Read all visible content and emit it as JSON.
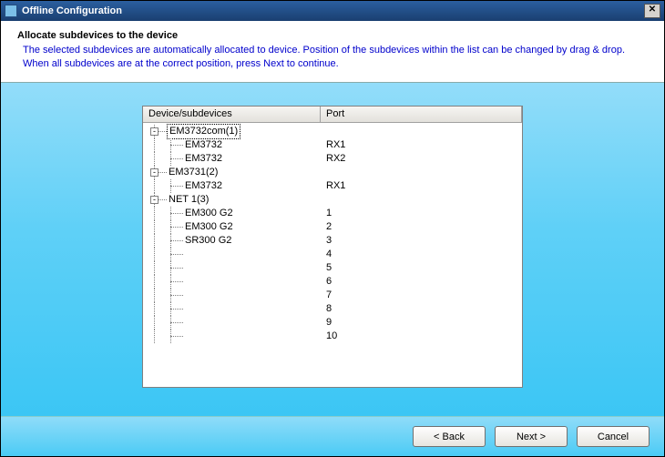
{
  "window": {
    "title": "Offline Configuration",
    "close_glyph": "✕"
  },
  "header": {
    "heading": "Allocate subdevices to the device",
    "subheading": "The selected subdevices are automatically allocated to device. Position of the subdevices within the list can be changed by drag & drop. When all subdevices are at the correct position, press Next to continue."
  },
  "columns": {
    "device": "Device/subdevices",
    "port": "Port"
  },
  "tree": [
    {
      "depth": 0,
      "expander": "-",
      "label": "EM3732com(1)",
      "port": "",
      "selected": true
    },
    {
      "depth": 1,
      "expander": "",
      "label": "EM3732",
      "port": "RX1"
    },
    {
      "depth": 1,
      "expander": "",
      "label": "EM3732",
      "port": "RX2"
    },
    {
      "depth": 0,
      "expander": "-",
      "label": "EM3731(2)",
      "port": ""
    },
    {
      "depth": 1,
      "expander": "",
      "label": "EM3732",
      "port": "RX1"
    },
    {
      "depth": 0,
      "expander": "-",
      "label": "NET 1(3)",
      "port": ""
    },
    {
      "depth": 1,
      "expander": "",
      "label": "EM300 G2",
      "port": "1"
    },
    {
      "depth": 1,
      "expander": "",
      "label": "EM300 G2",
      "port": "2"
    },
    {
      "depth": 1,
      "expander": "",
      "label": "SR300 G2",
      "port": "3"
    },
    {
      "depth": 1,
      "expander": "",
      "label": "",
      "port": "4"
    },
    {
      "depth": 1,
      "expander": "",
      "label": "",
      "port": "5"
    },
    {
      "depth": 1,
      "expander": "",
      "label": "",
      "port": "6"
    },
    {
      "depth": 1,
      "expander": "",
      "label": "",
      "port": "7"
    },
    {
      "depth": 1,
      "expander": "",
      "label": "",
      "port": "8"
    },
    {
      "depth": 1,
      "expander": "",
      "label": "",
      "port": "9"
    },
    {
      "depth": 1,
      "expander": "",
      "label": "",
      "port": "10"
    }
  ],
  "buttons": {
    "back": "< Back",
    "next": "Next >",
    "cancel": "Cancel"
  }
}
